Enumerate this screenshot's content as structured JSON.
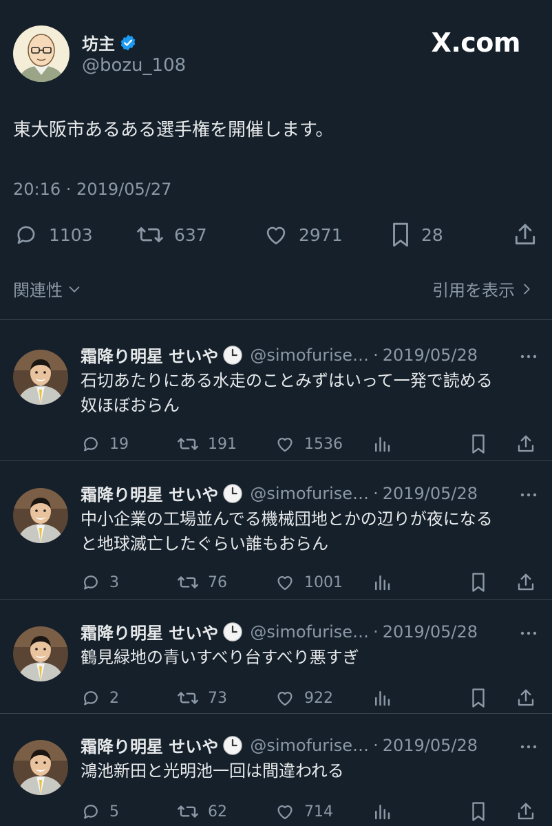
{
  "main": {
    "author_name": "坊主",
    "author_handle": "@bozu_108",
    "brand": "X.com",
    "text": "東大阪市あるある選手権を開催します。",
    "timestamp": "20:16 · 2019/05/27",
    "replies": "1103",
    "retweets": "637",
    "likes": "2971",
    "bookmarks": "28",
    "related_label": "関連性",
    "quotes_label": "引用を表示"
  },
  "colors": {
    "background": "#15202b",
    "text": "#e7e9ea",
    "muted": "#8b98a5",
    "verified": "#1d9bf0",
    "divider": "#38444d"
  },
  "replies": [
    {
      "name": "霜降り明星 せいや",
      "handle": "@simofurise…",
      "date": "2019/05/28",
      "lines": [
        "石切あたりにある水走のことみずはいって一発で読める",
        "奴ほぼおらん"
      ],
      "replies": "19",
      "retweets": "191",
      "likes": "1536"
    },
    {
      "name": "霜降り明星 せいや",
      "handle": "@simofurise…",
      "date": "2019/05/28",
      "lines": [
        "中小企業の工場並んでる機械団地とかの辺りが夜になる",
        "と地球滅亡したぐらい誰もおらん"
      ],
      "replies": "3",
      "retweets": "76",
      "likes": "1001"
    },
    {
      "name": "霜降り明星 せいや",
      "handle": "@simofurise…",
      "date": "2019/05/28",
      "lines": [
        "鶴見緑地の青いすべり台すべり悪すぎ"
      ],
      "replies": "2",
      "retweets": "73",
      "likes": "922"
    },
    {
      "name": "霜降り明星 せいや",
      "handle": "@simofurise…",
      "date": "2019/05/28",
      "lines": [
        "鴻池新田と光明池一回は間違われる"
      ],
      "replies": "5",
      "retweets": "62",
      "likes": "714"
    }
  ]
}
